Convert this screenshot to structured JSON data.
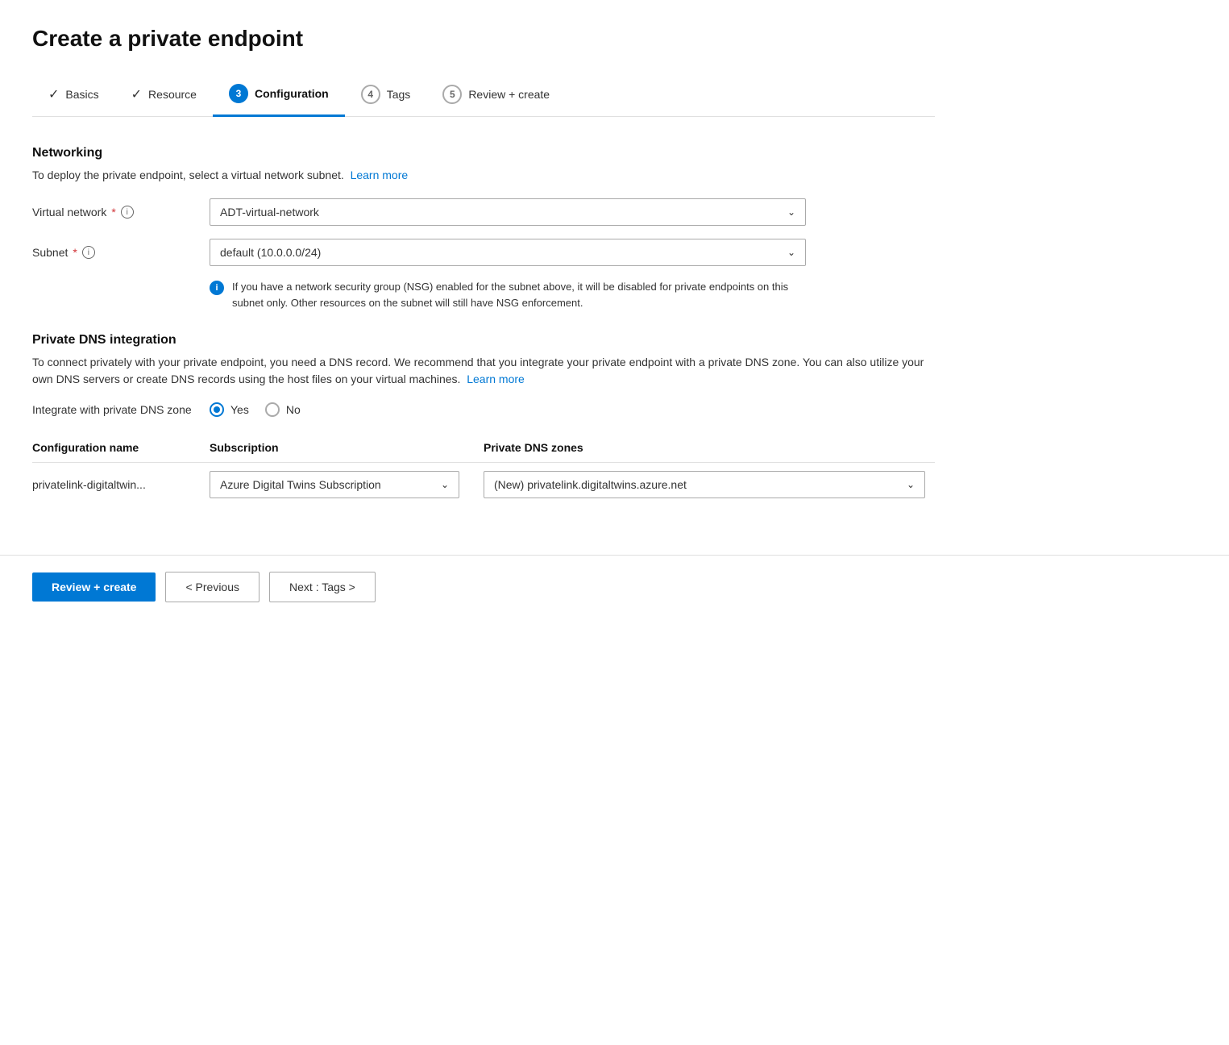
{
  "page": {
    "title": "Create a private endpoint"
  },
  "steps": [
    {
      "id": "basics",
      "label": "Basics",
      "state": "done",
      "number": "1"
    },
    {
      "id": "resource",
      "label": "Resource",
      "state": "done",
      "number": "2"
    },
    {
      "id": "configuration",
      "label": "Configuration",
      "state": "active",
      "number": "3"
    },
    {
      "id": "tags",
      "label": "Tags",
      "state": "pending",
      "number": "4"
    },
    {
      "id": "review",
      "label": "Review + create",
      "state": "pending",
      "number": "5"
    }
  ],
  "networking": {
    "title": "Networking",
    "description": "To deploy the private endpoint, select a virtual network subnet.",
    "learn_more": "Learn more",
    "virtual_network_label": "Virtual network",
    "virtual_network_value": "ADT-virtual-network",
    "subnet_label": "Subnet",
    "subnet_value": "default (10.0.0.0/24)",
    "nsg_info": "If you have a network security group (NSG) enabled for the subnet above, it will be disabled for private endpoints on this subnet only. Other resources on the subnet will still have NSG enforcement."
  },
  "dns": {
    "title": "Private DNS integration",
    "description": "To connect privately with your private endpoint, you need a DNS record. We recommend that you integrate your private endpoint with a private DNS zone. You can also utilize your own DNS servers or create DNS records using the host files on your virtual machines.",
    "learn_more": "Learn more",
    "integrate_label": "Integrate with private DNS zone",
    "radio_yes": "Yes",
    "radio_no": "No",
    "radio_selected": "yes",
    "table": {
      "col_name": "Configuration name",
      "col_sub": "Subscription",
      "col_zones": "Private DNS zones",
      "rows": [
        {
          "name": "privatelink-digitaltwin...",
          "subscription": "Azure Digital Twins Subscription",
          "zone": "(New) privatelink.digitaltwins.azure.net"
        }
      ]
    }
  },
  "footer": {
    "review_create": "Review + create",
    "previous": "< Previous",
    "next": "Next : Tags >"
  }
}
